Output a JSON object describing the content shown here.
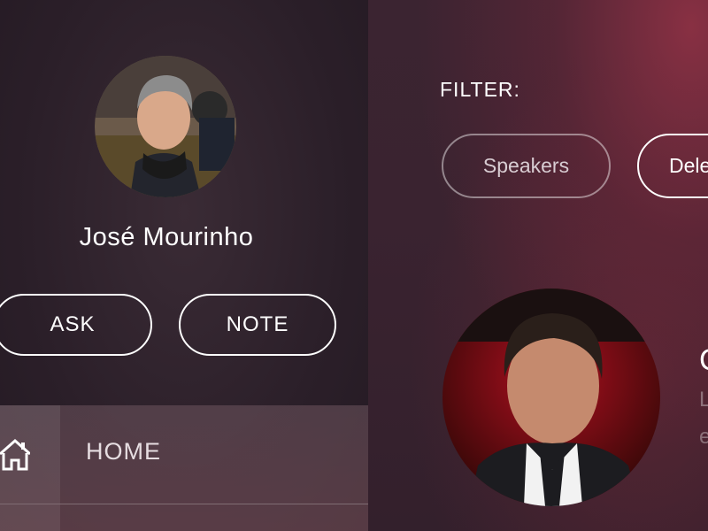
{
  "profile": {
    "name": "José Mourinho",
    "avatar_icon": "person-photo-icon",
    "actions": {
      "ask_label": "ASK",
      "note_label": "NOTE"
    }
  },
  "nav": {
    "items": [
      {
        "label": "HOME",
        "icon": "home-icon"
      }
    ]
  },
  "filter": {
    "label": "FILTER:",
    "chips": [
      {
        "label": "Speakers",
        "selected": false
      },
      {
        "label": "Dele",
        "selected": true
      }
    ]
  },
  "speaker_card": {
    "avatar_icon": "person-photo-icon",
    "title_partial": "C",
    "line1_partial": "L",
    "line2_partial": "e"
  },
  "colors": {
    "accent": "#8a2c40",
    "text": "#ffffff",
    "muted": "#d8ccd2"
  }
}
